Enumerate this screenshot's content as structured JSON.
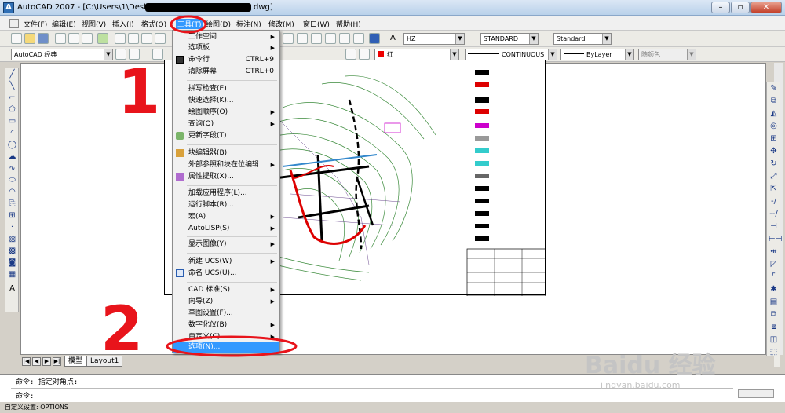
{
  "app": {
    "title": "AutoCAD 2007 - [C:\\Users\\1\\Desktop\\",
    "title_suffix": "dwg]",
    "window_buttons": [
      "–",
      "▫",
      "✕"
    ]
  },
  "menubar": {
    "items": [
      "文件(F)",
      "编辑(E)",
      "视图(V)",
      "插入(I)",
      "格式(O)",
      "工具(T)",
      "绘图(D)",
      "标注(N)",
      "修改(M)",
      "窗口(W)",
      "帮助(H)"
    ]
  },
  "toolbar": {
    "textstyle": "HZ",
    "dimstyle": "STANDARD",
    "tablestyle": "Standard",
    "workspace": "AutoCAD 经典",
    "color": "红",
    "linetype": "CONTINUOUS",
    "lineweight": "ByLayer",
    "plotstyle": "随颜色"
  },
  "tools_menu": {
    "items": [
      {
        "label": "工作空间",
        "shortcut": "",
        "submenu": true,
        "icon": ""
      },
      {
        "label": "选项板",
        "shortcut": "",
        "submenu": true,
        "icon": ""
      },
      {
        "label": "命令行",
        "shortcut": "CTRL+9",
        "submenu": false,
        "icon": "command-line-icon"
      },
      {
        "label": "清除屏幕",
        "shortcut": "CTRL+0",
        "submenu": false,
        "icon": ""
      },
      {
        "label": "拼写检查(E)",
        "shortcut": "",
        "submenu": false,
        "icon": ""
      },
      {
        "label": "快速选择(K)...",
        "shortcut": "",
        "submenu": false,
        "icon": ""
      },
      {
        "label": "绘图顺序(O)",
        "shortcut": "",
        "submenu": true,
        "icon": ""
      },
      {
        "label": "查询(Q)",
        "shortcut": "",
        "submenu": true,
        "icon": ""
      },
      {
        "label": "更新字段(T)",
        "shortcut": "",
        "submenu": false,
        "icon": "update-field-icon"
      },
      {
        "label": "块编辑器(B)",
        "shortcut": "",
        "submenu": false,
        "icon": "block-editor-icon"
      },
      {
        "label": "外部参照和块在位编辑",
        "shortcut": "",
        "submenu": true,
        "icon": ""
      },
      {
        "label": "属性提取(X)...",
        "shortcut": "",
        "submenu": false,
        "icon": "attribute-extract-icon"
      },
      {
        "label": "加载应用程序(L)...",
        "shortcut": "",
        "submenu": false,
        "icon": ""
      },
      {
        "label": "运行脚本(R)...",
        "shortcut": "",
        "submenu": false,
        "icon": ""
      },
      {
        "label": "宏(A)",
        "shortcut": "",
        "submenu": true,
        "icon": ""
      },
      {
        "label": "AutoLISP(S)",
        "shortcut": "",
        "submenu": true,
        "icon": ""
      },
      {
        "label": "显示图像(Y)",
        "shortcut": "",
        "submenu": true,
        "icon": ""
      },
      {
        "label": "新建 UCS(W)",
        "shortcut": "",
        "submenu": true,
        "icon": ""
      },
      {
        "label": "命名 UCS(U)...",
        "shortcut": "",
        "submenu": false,
        "icon": "named-ucs-icon"
      },
      {
        "label": "CAD 标准(S)",
        "shortcut": "",
        "submenu": true,
        "icon": ""
      },
      {
        "label": "向导(Z)",
        "shortcut": "",
        "submenu": true,
        "icon": ""
      },
      {
        "label": "草图设置(F)...",
        "shortcut": "",
        "submenu": false,
        "icon": ""
      },
      {
        "label": "数字化仪(B)",
        "shortcut": "",
        "submenu": true,
        "icon": ""
      },
      {
        "label": "自定义(C)",
        "shortcut": "",
        "submenu": true,
        "icon": ""
      },
      {
        "label": "选项(N)...",
        "shortcut": "",
        "submenu": false,
        "icon": ""
      }
    ],
    "selected": "选项(N)..."
  },
  "tabs": {
    "nav": [
      "|◀",
      "◀",
      "▶",
      "▶|"
    ],
    "model": "模型",
    "layout1": "Layout1"
  },
  "command": {
    "line1": "命令: 指定对角点:",
    "line2": "命令:"
  },
  "status": {
    "text": "自定义设置:  OPTIONS"
  },
  "annotations": {
    "step1": "1",
    "step2": "2",
    "color": "#e8141b"
  },
  "watermark": {
    "text": "Baidu 经验",
    "url": "jingyan.baidu.com"
  }
}
